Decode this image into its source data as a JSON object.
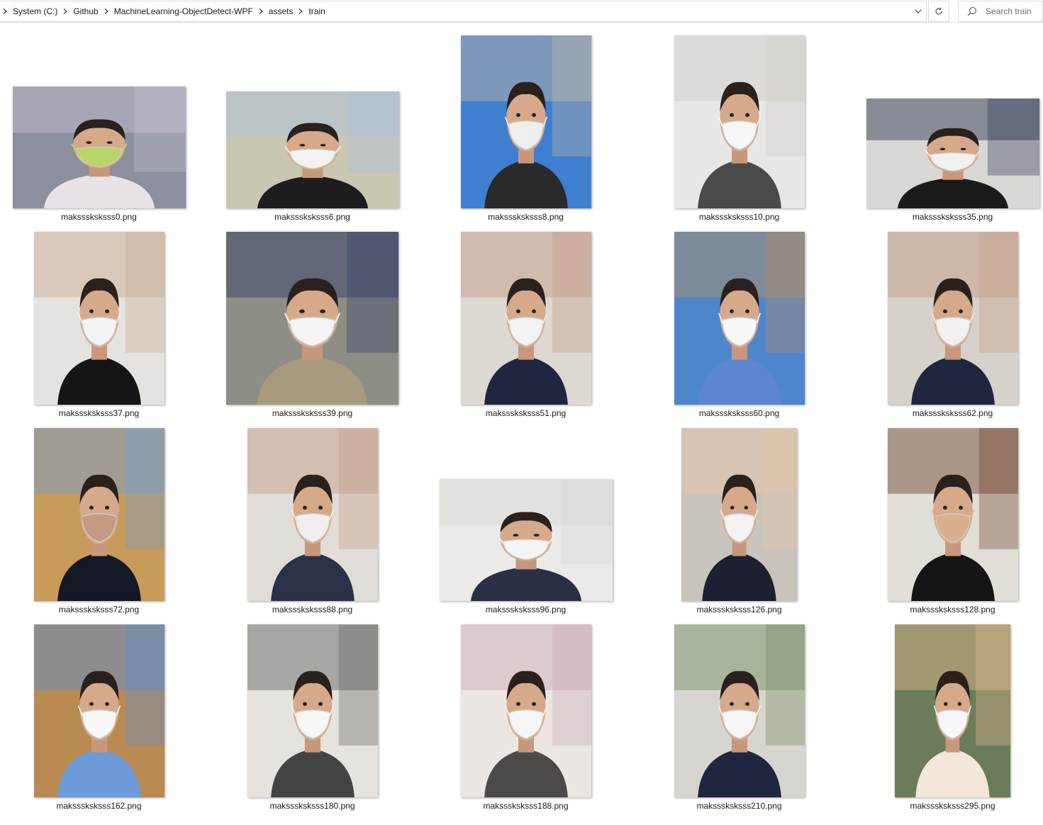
{
  "address_bar": {
    "breadcrumbs": [
      "System (C:)",
      "Github",
      "MachineLearning-ObjectDetect-WPF",
      "assets",
      "train"
    ]
  },
  "search": {
    "placeholder": "Search train"
  },
  "files": [
    {
      "name": "maksssksksss0.png",
      "orientation": "landscape",
      "palette": [
        "#8b8f9e",
        "#c9c3cf",
        "#e8e2e7",
        "#b9d56a"
      ]
    },
    {
      "name": "maksssksksss6.png",
      "orientation": "landscape",
      "palette": [
        "#c9c7b2",
        "#a8c0df",
        "#1d1d1d",
        "#f2f2f2"
      ]
    },
    {
      "name": "maksssksksss8.png",
      "orientation": "portrait",
      "palette": [
        "#3f7fd0",
        "#c9b9a1",
        "#2a2a2a",
        "#eeeeee"
      ]
    },
    {
      "name": "maksssksksss10.png",
      "orientation": "portrait",
      "palette": [
        "#e9e7e6",
        "#cfcac6",
        "#4a4a48",
        "#f6f6f6"
      ]
    },
    {
      "name": "maksssksksss35.png",
      "orientation": "landscape",
      "palette": [
        "#d9d7d3",
        "#26304a",
        "#1a1a1a",
        "#f0f0f0"
      ]
    },
    {
      "name": "maksssksksss37.png",
      "orientation": "portrait",
      "palette": [
        "#e5e3e0",
        "#c9a98e",
        "#151515",
        "#f3f3f3"
      ]
    },
    {
      "name": "maksssksksss39.png",
      "orientation": "portrait",
      "palette": [
        "#8e8e86",
        "#2d3a66",
        "#a79a7d",
        "#f4f4f4"
      ]
    },
    {
      "name": "maksssksksss51.png",
      "orientation": "portrait",
      "palette": [
        "#ded8d2",
        "#c49a83",
        "#1f2640",
        "#f2f2f2"
      ]
    },
    {
      "name": "maksssksksss60.png",
      "orientation": "portrait",
      "palette": [
        "#4e86cc",
        "#b9905e",
        "#5b86d0",
        "#f8f8f8"
      ]
    },
    {
      "name": "maksssksksss62.png",
      "orientation": "portrait",
      "palette": [
        "#d7d1cb",
        "#c49a83",
        "#1f2640",
        "#f1f1f1"
      ]
    },
    {
      "name": "maksssksksss72.png",
      "orientation": "portrait",
      "palette": [
        "#c89b59",
        "#6f9ed6",
        "#151826",
        "#c49a83"
      ]
    },
    {
      "name": "maksssksksss88.png",
      "orientation": "portrait",
      "palette": [
        "#e0ddd8",
        "#c49a83",
        "#2a3149",
        "#eeeeee"
      ]
    },
    {
      "name": "maksssksksss96.png",
      "orientation": "landscape",
      "palette": [
        "#eceae8",
        "#d8d6d2",
        "#2b2f45",
        "#f4f4f4"
      ]
    },
    {
      "name": "maksssksksss126.png",
      "orientation": "portrait",
      "palette": [
        "#c9c4bc",
        "#e8c6a8",
        "#1d2030",
        "#f3f3f3"
      ]
    },
    {
      "name": "maksssksksss128.png",
      "orientation": "portrait",
      "palette": [
        "#e1ddd7",
        "#6a3d24",
        "#151515",
        "#d9b08f"
      ]
    },
    {
      "name": "maksssksksss162.png",
      "orientation": "portrait",
      "palette": [
        "#b98a52",
        "#5a8fd8",
        "#6d9ad8",
        "#f7f7f7"
      ]
    },
    {
      "name": "maksssksksss180.png",
      "orientation": "portrait",
      "palette": [
        "#e6e2dd",
        "#5e5e5c",
        "#444442",
        "#f5f5f5"
      ]
    },
    {
      "name": "maksssksksss188.png",
      "orientation": "portrait",
      "palette": [
        "#ebe6e2",
        "#c9a9b3",
        "#4b4a48",
        "#f5f5f5"
      ]
    },
    {
      "name": "maksssksksss210.png",
      "orientation": "portrait",
      "palette": [
        "#d8d5d0",
        "#6f8b5c",
        "#1f2640",
        "#f5f5f5"
      ]
    },
    {
      "name": "maksssksksss295.png",
      "orientation": "portrait",
      "palette": [
        "#6a7c5a",
        "#e5b98f",
        "#f2e7da",
        "#f7f7f7"
      ]
    }
  ]
}
